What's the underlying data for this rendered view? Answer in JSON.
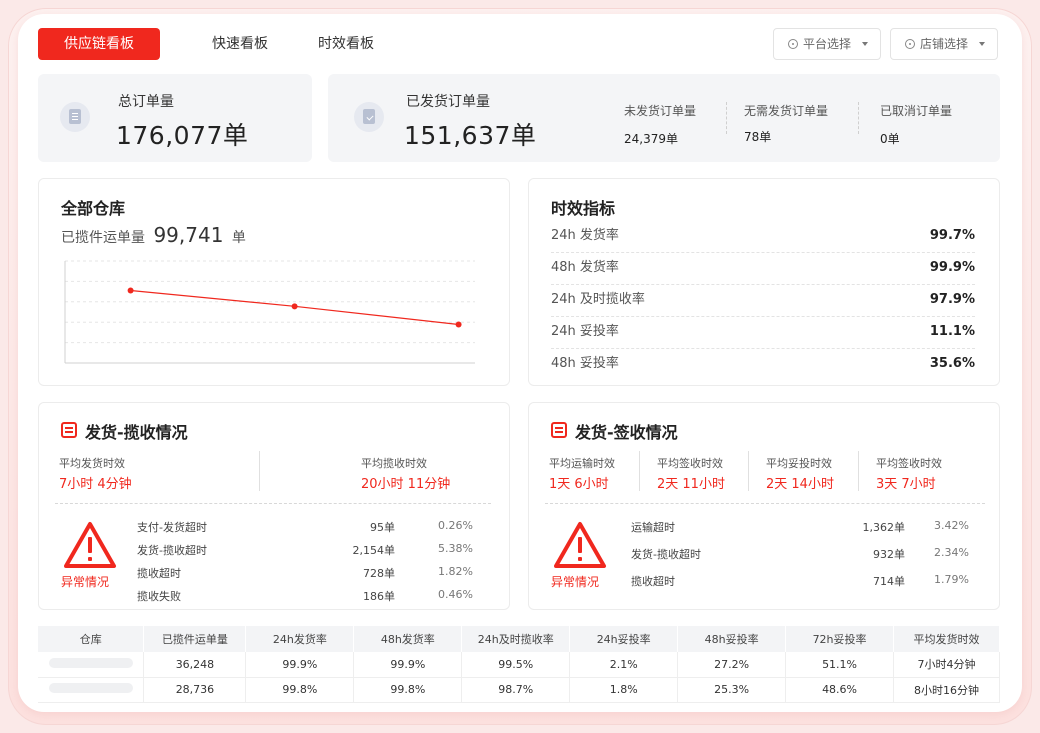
{
  "nav": {
    "tabs": [
      {
        "label": "供应链看板",
        "active": true
      },
      {
        "label": "快速看板",
        "active": false
      },
      {
        "label": "时效看板",
        "active": false
      }
    ],
    "platform_select": "平台选择",
    "store_select": "店铺选择"
  },
  "summary": {
    "total_orders_label": "总订单量",
    "total_orders_value": "176,077单",
    "shipped_label": "已发货订单量",
    "shipped_value": "151,637单",
    "unshipped_label": "未发货订单量",
    "unshipped_value": "24,379单",
    "no_ship_label": "无需发货订单量",
    "no_ship_value": "78单",
    "cancelled_label": "已取消订单量",
    "cancelled_value": "0单"
  },
  "warehouse": {
    "title": "全部仓库",
    "collected_label": "已揽件运单量",
    "collected_value": "99,741",
    "collected_unit": "单"
  },
  "chart_data": {
    "type": "line",
    "x": [
      1,
      2,
      3
    ],
    "series": [
      {
        "values": [
          82,
          75,
          67
        ]
      }
    ],
    "ylim": [
      50,
      95
    ],
    "grid": true,
    "color": "#f0281e"
  },
  "timeliness": {
    "title": "时效指标",
    "rows": [
      {
        "label": "24h 发货率",
        "value": "99.7%"
      },
      {
        "label": "48h 发货率",
        "value": "99.9%"
      },
      {
        "label": "24h 及时揽收率",
        "value": "97.9%"
      },
      {
        "label": "24h 妥投率",
        "value": "11.1%"
      },
      {
        "label": "48h 妥投率",
        "value": "35.6%"
      }
    ]
  },
  "pickup": {
    "title": "发货-揽收情况",
    "avg_ship_label": "平均发货时效",
    "avg_ship_value": "7小时 4分钟",
    "avg_pickup_label": "平均揽收时效",
    "avg_pickup_value": "20小时 11分钟",
    "abnormal_label": "异常情况",
    "rows": [
      {
        "label": "支付-发货超时",
        "count": "95单",
        "pct": "0.26%"
      },
      {
        "label": "发货-揽收超时",
        "count": "2,154单",
        "pct": "5.38%"
      },
      {
        "label": "揽收超时",
        "count": "728单",
        "pct": "1.82%"
      },
      {
        "label": "揽收失败",
        "count": "186单",
        "pct": "0.46%"
      }
    ]
  },
  "signing": {
    "title": "发货-签收情况",
    "metrics": [
      {
        "label": "平均运输时效",
        "value": "1天 6小时"
      },
      {
        "label": "平均签收时效",
        "value": "2天 11小时"
      },
      {
        "label": "平均妥投时效",
        "value": "2天 14小时"
      },
      {
        "label": "平均签收时效",
        "value": "3天 7小时"
      }
    ],
    "abnormal_label": "异常情况",
    "rows": [
      {
        "label": "运输超时",
        "count": "1,362单",
        "pct": "3.42%"
      },
      {
        "label": "发货-揽收超时",
        "count": "932单",
        "pct": "2.34%"
      },
      {
        "label": "揽收超时",
        "count": "714单",
        "pct": "1.79%"
      }
    ]
  },
  "table": {
    "headers": [
      "仓库",
      "已揽件运单量",
      "24h发货率",
      "48h发货率",
      "24h及时揽收率",
      "24h妥投率",
      "48h妥投率",
      "72h妥投率",
      "平均发货时效"
    ],
    "rows": [
      [
        "",
        "36,248",
        "99.9%",
        "99.9%",
        "99.5%",
        "2.1%",
        "27.2%",
        "51.1%",
        "7小时4分钟"
      ],
      [
        "",
        "28,736",
        "99.8%",
        "99.8%",
        "98.7%",
        "1.8%",
        "25.3%",
        "48.6%",
        "8小时16分钟"
      ]
    ]
  }
}
